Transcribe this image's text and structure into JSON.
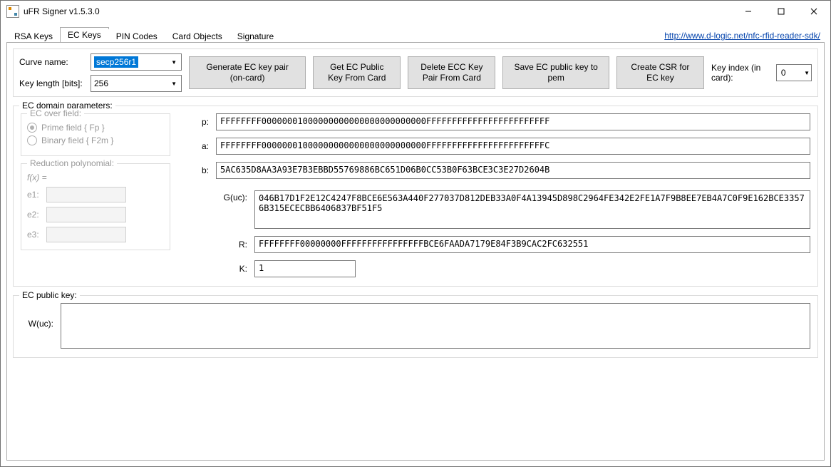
{
  "window": {
    "title": "uFR Signer v1.5.3.0"
  },
  "header_link": "http://www.d-logic.net/nfc-rfid-reader-sdk/",
  "tabs": [
    {
      "label": "RSA Keys"
    },
    {
      "label": "EC Keys"
    },
    {
      "label": "PIN Codes"
    },
    {
      "label": "Card Objects"
    },
    {
      "label": "Signature"
    }
  ],
  "curve": {
    "name_label": "Curve name:",
    "name_value": "secp256r1",
    "keylen_label": "Key length [bits]:",
    "keylen_value": "256"
  },
  "buttons": {
    "generate": "Generate EC key pair (on-card)",
    "get_pub": "Get EC Public Key From Card",
    "delete": "Delete ECC Key Pair From Card",
    "save_pem": "Save EC public key to pem",
    "csr": "Create CSR for EC key"
  },
  "keyindex": {
    "label": "Key index (in card):",
    "value": "0"
  },
  "params": {
    "legend": "EC domain parameters:",
    "field_legend": "EC over field:",
    "prime_label": "Prime field { Fp }",
    "binary_label": "Binary field { F2m }",
    "poly_legend": "Reduction polynomial:",
    "fx_label": "f(x) =",
    "e1_label": "e1:",
    "e2_label": "e2:",
    "e3_label": "e3:",
    "p_label": "p:",
    "p": "FFFFFFFF00000001000000000000000000000000FFFFFFFFFFFFFFFFFFFFFFFF",
    "a_label": "a:",
    "a": "FFFFFFFF00000001000000000000000000000000FFFFFFFFFFFFFFFFFFFFFFFC",
    "b_label": "b:",
    "b": "5AC635D8AA3A93E7B3EBBD55769886BC651D06B0CC53B0F63BCE3C3E27D2604B",
    "g_label": "G(uc):",
    "g": "046B17D1F2E12C4247F8BCE6E563A440F277037D812DEB33A0F4A13945D898C2964FE342E2FE1A7F9B8EE7EB4A7C0F9E162BCE33576B315ECECBB6406837BF51F5",
    "r_label": "R:",
    "r": "FFFFFFFF00000000FFFFFFFFFFFFFFFFBCE6FAADA7179E84F3B9CAC2FC632551",
    "k_label": "K:",
    "k": "1"
  },
  "pubkey": {
    "legend": "EC public key:",
    "w_label": "W(uc):",
    "w": ""
  }
}
